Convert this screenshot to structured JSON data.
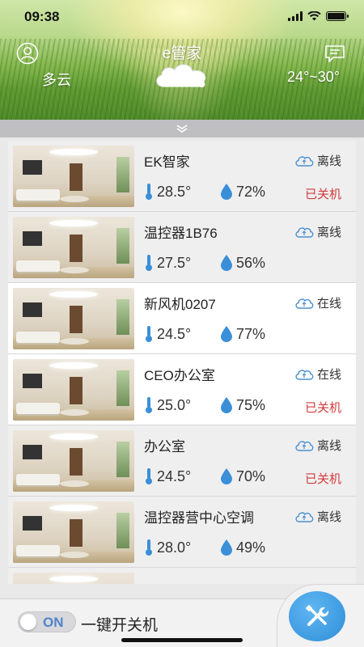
{
  "statusbar": {
    "time": "09:38"
  },
  "header": {
    "title": "e管家",
    "weather": "多云",
    "temperature": "24°~30°"
  },
  "devices": [
    {
      "name": "EK智家",
      "temp": "28.5°",
      "humidity": "72%",
      "connection": "离线",
      "power": "已关机",
      "online": false
    },
    {
      "name": "温控器1B76",
      "temp": "27.5°",
      "humidity": "56%",
      "connection": "离线",
      "power": "",
      "online": false
    },
    {
      "name": "新风机0207",
      "temp": "24.5°",
      "humidity": "77%",
      "connection": "在线",
      "power": "",
      "online": true
    },
    {
      "name": "CEO办公室",
      "temp": "25.0°",
      "humidity": "75%",
      "connection": "在线",
      "power": "已关机",
      "online": true
    },
    {
      "name": "办公室",
      "temp": "24.5°",
      "humidity": "70%",
      "connection": "离线",
      "power": "已关机",
      "online": false
    },
    {
      "name": "温控器营中心空调",
      "temp": "28.0°",
      "humidity": "49%",
      "connection": "离线",
      "power": "",
      "online": false
    },
    {
      "name": "",
      "temp": "",
      "humidity": "",
      "connection": "",
      "power": "",
      "online": false
    }
  ],
  "bottom": {
    "toggle_label": "ON",
    "power_all_label": "一键开关机"
  },
  "colors": {
    "accent": "#3a8fd8",
    "offline_red": "#d23b3b",
    "cloud_blue": "#4a90d0"
  },
  "icons": {
    "user": "user-icon",
    "message": "message-icon",
    "weather": "cloud-icon",
    "collapse": "chevron-down-icon",
    "connection": "cloud-sync-icon",
    "temperature": "thermometer-icon",
    "humidity": "droplet-icon",
    "tools": "tools-icon"
  }
}
